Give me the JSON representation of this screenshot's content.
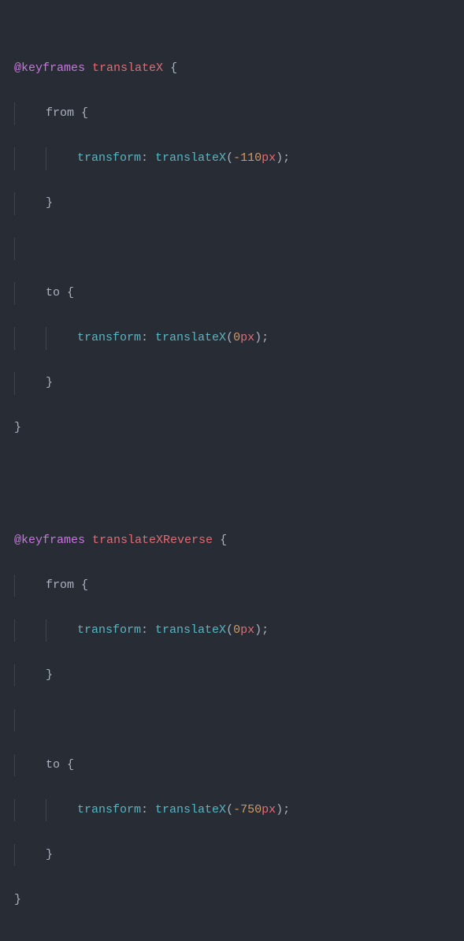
{
  "code": {
    "rules": [
      {
        "at": "@keyframes",
        "name": "translateX",
        "brace_open": "{",
        "keyframes": [
          {
            "selector": "from",
            "brace_open": "{",
            "decl": {
              "prop": "transform",
              "colon": ":",
              "fn": "translateX",
              "paren_open": "(",
              "value": "-110",
              "unit": "px",
              "paren_close": ")",
              "semicolon": ";"
            },
            "brace_close": "}"
          },
          {
            "selector": "to",
            "brace_open": "{",
            "decl": {
              "prop": "transform",
              "colon": ":",
              "fn": "translateX",
              "paren_open": "(",
              "value": "0",
              "unit": "px",
              "paren_close": ")",
              "semicolon": ";"
            },
            "brace_close": "}"
          }
        ],
        "brace_close": "}"
      },
      {
        "at": "@keyframes",
        "name": "translateXReverse",
        "brace_open": "{",
        "keyframes": [
          {
            "selector": "from",
            "brace_open": "{",
            "decl": {
              "prop": "transform",
              "colon": ":",
              "fn": "translateX",
              "paren_open": "(",
              "value": "0",
              "unit": "px",
              "paren_close": ")",
              "semicolon": ";"
            },
            "brace_close": "}"
          },
          {
            "selector": "to",
            "brace_open": "{",
            "decl": {
              "prop": "transform",
              "colon": ":",
              "fn": "translateX",
              "paren_open": "(",
              "value": "-750",
              "unit": "px",
              "paren_close": ")",
              "semicolon": ";"
            },
            "brace_close": "}"
          }
        ],
        "brace_close": "}"
      }
    ]
  }
}
